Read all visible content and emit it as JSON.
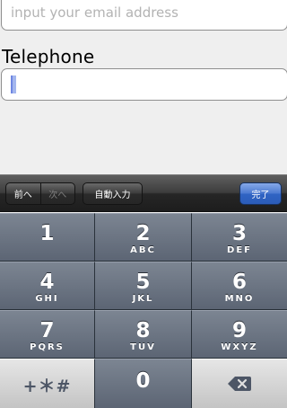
{
  "form": {
    "email_placeholder": "input your email address",
    "telephone_label": "Telephone",
    "telephone_value": ""
  },
  "toolbar": {
    "prev_label": "前へ",
    "next_label": "次へ",
    "autofill_label": "自動入力",
    "done_label": "完了"
  },
  "keypad": {
    "keys": [
      {
        "num": "1",
        "letters": ""
      },
      {
        "num": "2",
        "letters": "ABC"
      },
      {
        "num": "3",
        "letters": "DEF"
      },
      {
        "num": "4",
        "letters": "GHI"
      },
      {
        "num": "5",
        "letters": "JKL"
      },
      {
        "num": "6",
        "letters": "MNO"
      },
      {
        "num": "7",
        "letters": "PQRS"
      },
      {
        "num": "8",
        "letters": "TUV"
      },
      {
        "num": "9",
        "letters": "WXYZ"
      }
    ],
    "symbols_label": "+＊#",
    "zero": "0",
    "backspace_icon": "backspace-icon"
  },
  "colors": {
    "done_button": "#3064c4",
    "keypad_key": "#6a7381",
    "caret": "#a3b6ee"
  }
}
